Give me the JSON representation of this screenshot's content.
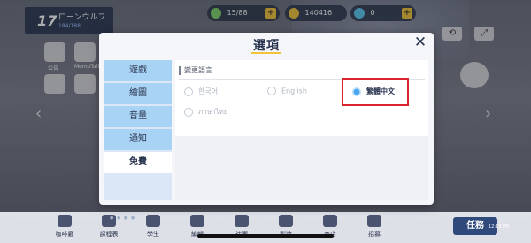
{
  "hud": {
    "level": "17",
    "player_name": "ローンウルフ",
    "exp": "184/188",
    "ap": "15/88",
    "credits": "140416",
    "gems": "0"
  },
  "side_icons": {
    "notice": "公告",
    "momo": "MomoTalk"
  },
  "bottom_nav": [
    {
      "label": "咖啡廳"
    },
    {
      "label": "課程表"
    },
    {
      "label": "學生"
    },
    {
      "label": "編輯"
    },
    {
      "label": "社團"
    },
    {
      "label": "製造"
    },
    {
      "label": "商店"
    },
    {
      "label": "招募"
    }
  ],
  "task_label": "任務",
  "clock": "12:13 PM",
  "dialog": {
    "title": "選項",
    "tabs": [
      {
        "label": "遊戲"
      },
      {
        "label": "繪圖"
      },
      {
        "label": "音量"
      },
      {
        "label": "通知"
      },
      {
        "label": "免費"
      }
    ],
    "section_label": "變更語言",
    "languages": [
      {
        "label": "한국어",
        "selected": false
      },
      {
        "label": "English",
        "selected": false
      },
      {
        "label": "繁體中文",
        "selected": true
      },
      {
        "label": "ภาษาไทย",
        "selected": false
      }
    ]
  },
  "colors": {
    "accent": "#f2c43a",
    "tab_blue": "#a9d3f5",
    "highlight_red": "#d9232d",
    "radio_selected": "#4aa7f0"
  }
}
